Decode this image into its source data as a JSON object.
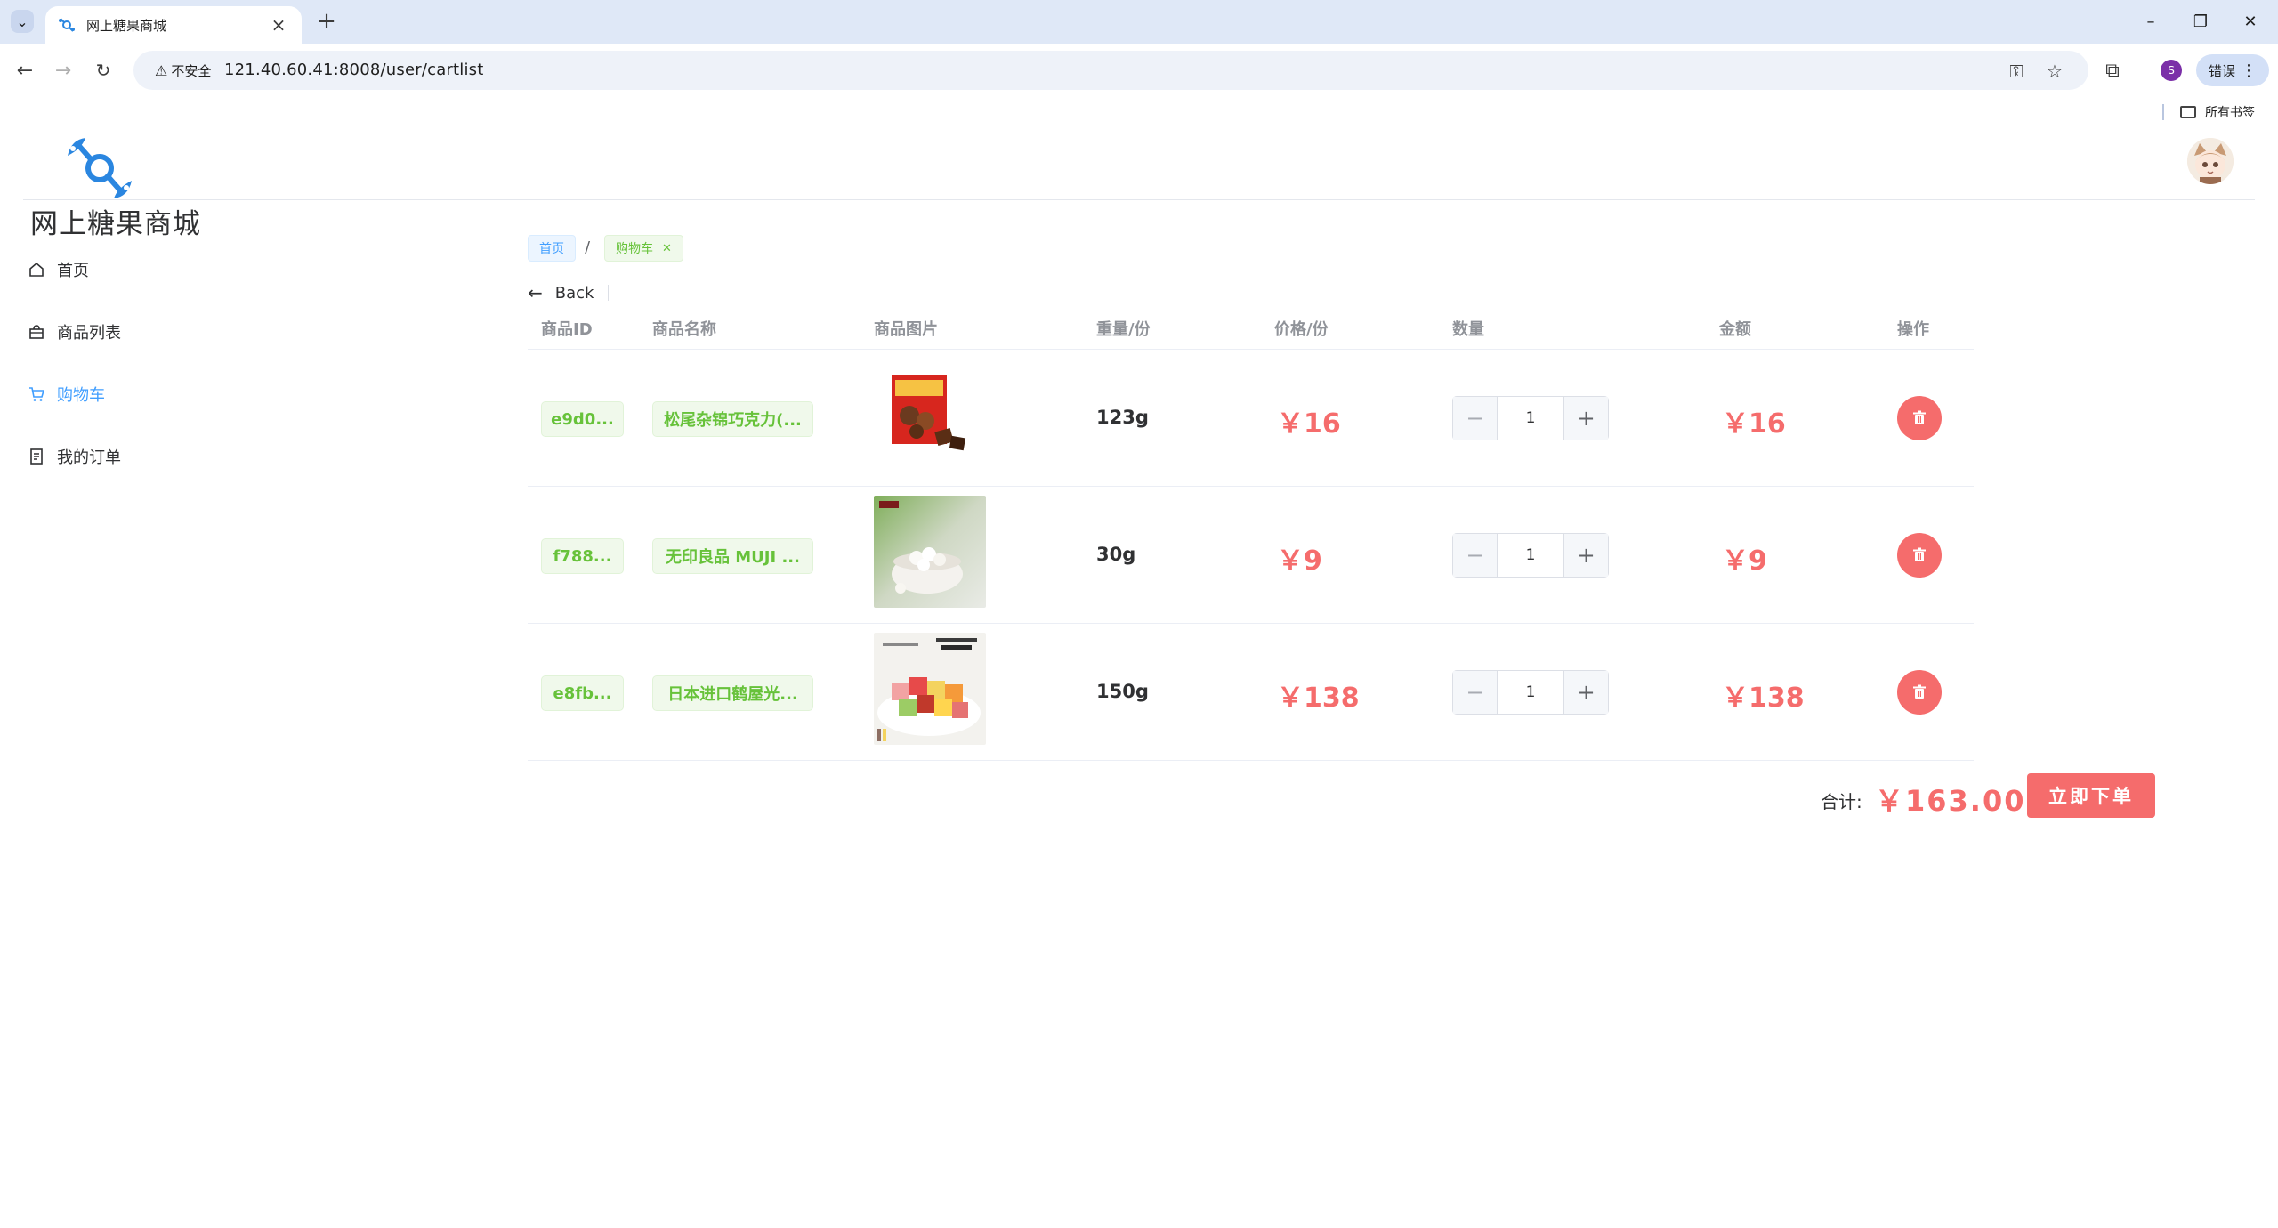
{
  "browser": {
    "tab_title": "网上糖果商城",
    "security_label": "不安全",
    "url": "121.40.60.41:8008/user/cartlist",
    "profile_initial": "S",
    "error_label": "错误",
    "bookmarks_folder": "所有书签"
  },
  "app": {
    "title": "网上糖果商城"
  },
  "sidebar": {
    "items": [
      {
        "label": "首页",
        "icon": "home-icon"
      },
      {
        "label": "商品列表",
        "icon": "shopping-bag-icon"
      },
      {
        "label": "购物车",
        "icon": "cart-icon"
      },
      {
        "label": "我的订单",
        "icon": "document-icon"
      }
    ],
    "active_index": 2
  },
  "breadcrumb": {
    "home": "首页",
    "separator": "/",
    "current": "购物车"
  },
  "back_label": "Back",
  "cart": {
    "headers": [
      "商品ID",
      "商品名称",
      "商品图片",
      "重量/份",
      "价格/份",
      "数量",
      "金额",
      "操作"
    ],
    "rows": [
      {
        "id": "e9d0...",
        "name": "松尾杂锦巧克力(...",
        "weight": "123g",
        "price": "￥16",
        "qty": "1",
        "amount": "￥16"
      },
      {
        "id": "f788...",
        "name": "无印良品 MUJI ...",
        "weight": "30g",
        "price": "￥9",
        "qty": "1",
        "amount": "￥9"
      },
      {
        "id": "e8fb...",
        "name": "日本进口鹤屋光...",
        "weight": "150g",
        "price": "￥138",
        "qty": "1",
        "amount": "￥138"
      }
    ],
    "total_label": "合计:",
    "total_value": "￥163.00",
    "order_button": "立即下单"
  },
  "colors": {
    "primary": "#409eff",
    "success": "#67c23a",
    "danger": "#f56c6c",
    "chrome_bg": "#dfe8f7"
  }
}
